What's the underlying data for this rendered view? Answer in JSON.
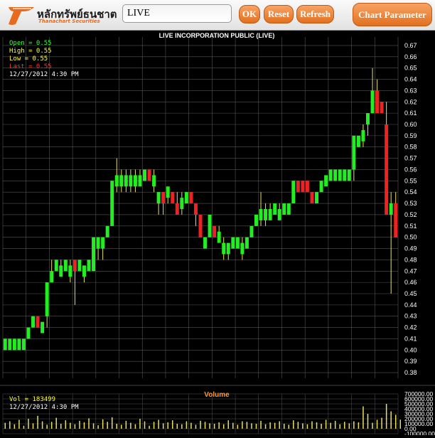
{
  "header": {
    "brand_text": "หลักทรัพย์ธนชาต",
    "brand_sub": "Thanachart Securities",
    "symbol_value": "LIVE",
    "ok_label": "OK",
    "reset_label": "Reset",
    "refresh_label": "Refresh",
    "chart_param_label": "Chart Parameter"
  },
  "ohlc": {
    "open": "Open = 0.55",
    "high": "High = 0.55",
    "low": "Low = 0.55",
    "last": "Last = 0.55",
    "timestamp": "12/27/2012 4:30 PM"
  },
  "volume_panel": {
    "title": "Volume",
    "vol_text": "Vol = 183499",
    "timestamp": "12/27/2012 4:30 PM"
  },
  "colors": {
    "up": "#22ee22",
    "down": "#ee2222",
    "wick": "#e8e060",
    "grid": "#555555",
    "label": "#ffffff",
    "open_label": "#33ff33",
    "high_label": "#ffff33",
    "low_label": "#ffff33",
    "last_label": "#ff3333",
    "volume_title": "#ff9933"
  },
  "chart_data": [
    {
      "type": "candlestick",
      "title": "LIVE INCORPORATION PUBLIC (LIVE)",
      "ylim": [
        0.375,
        0.675
      ],
      "y_ticks": [
        "0.67",
        "0.66",
        "0.65",
        "0.64",
        "0.63",
        "0.62",
        "0.61",
        "0.60",
        "0.59",
        "0.58",
        "0.57",
        "0.56",
        "0.55",
        "0.54",
        "0.53",
        "0.52",
        "0.51",
        "0.50",
        "0.49",
        "0.48",
        "0.47",
        "0.46",
        "0.45",
        "0.44",
        "0.43",
        "0.42",
        "0.41",
        "0.40",
        "0.39",
        "0.38"
      ],
      "grid": true,
      "candles": [
        [
          0.4,
          0.41,
          0.4,
          0.41
        ],
        [
          0.4,
          0.41,
          0.4,
          0.41
        ],
        [
          0.4,
          0.41,
          0.4,
          0.41
        ],
        [
          0.4,
          0.41,
          0.4,
          0.41
        ],
        [
          0.4,
          0.41,
          0.4,
          0.41
        ],
        [
          0.41,
          0.42,
          0.41,
          0.42
        ],
        [
          0.42,
          0.43,
          0.42,
          0.43
        ],
        [
          0.43,
          0.43,
          0.42,
          0.42
        ],
        [
          0.42,
          0.42,
          0.42,
          0.42
        ],
        [
          0.43,
          0.46,
          0.42,
          0.46
        ],
        [
          0.46,
          0.48,
          0.46,
          0.47
        ],
        [
          0.47,
          0.48,
          0.47,
          0.48
        ],
        [
          0.47,
          0.48,
          0.47,
          0.47
        ],
        [
          0.47,
          0.48,
          0.47,
          0.48
        ],
        [
          0.47,
          0.48,
          0.46,
          0.47
        ],
        [
          0.48,
          0.48,
          0.44,
          0.47
        ],
        [
          0.47,
          0.48,
          0.47,
          0.48
        ],
        [
          0.47,
          0.47,
          0.46,
          0.47
        ],
        [
          0.47,
          0.48,
          0.47,
          0.48
        ],
        [
          0.47,
          0.5,
          0.47,
          0.5
        ],
        [
          0.49,
          0.5,
          0.48,
          0.5
        ],
        [
          0.49,
          0.5,
          0.48,
          0.5
        ],
        [
          0.5,
          0.51,
          0.5,
          0.51
        ],
        [
          0.51,
          0.55,
          0.51,
          0.55
        ],
        [
          0.55,
          0.57,
          0.54,
          0.55
        ],
        [
          0.55,
          0.56,
          0.54,
          0.55
        ],
        [
          0.55,
          0.56,
          0.54,
          0.55
        ],
        [
          0.55,
          0.56,
          0.54,
          0.55
        ],
        [
          0.55,
          0.56,
          0.54,
          0.55
        ],
        [
          0.55,
          0.56,
          0.55,
          0.55
        ],
        [
          0.55,
          0.56,
          0.55,
          0.56
        ],
        [
          0.56,
          0.56,
          0.55,
          0.55
        ],
        [
          0.55,
          0.56,
          0.54,
          0.55
        ],
        [
          0.53,
          0.54,
          0.52,
          0.54
        ],
        [
          0.54,
          0.54,
          0.52,
          0.53
        ],
        [
          0.54,
          0.54,
          0.53,
          0.54
        ],
        [
          0.54,
          0.54,
          0.53,
          0.53
        ],
        [
          0.53,
          0.54,
          0.52,
          0.52
        ],
        [
          0.53,
          0.54,
          0.52,
          0.53
        ],
        [
          0.53,
          0.54,
          0.53,
          0.54
        ],
        [
          0.54,
          0.54,
          0.53,
          0.53
        ],
        [
          0.53,
          0.53,
          0.51,
          0.52
        ],
        [
          0.52,
          0.52,
          0.5,
          0.5
        ],
        [
          0.49,
          0.5,
          0.49,
          0.5
        ],
        [
          0.5,
          0.52,
          0.5,
          0.52
        ],
        [
          0.51,
          0.51,
          0.5,
          0.5
        ],
        [
          0.5,
          0.51,
          0.5,
          0.5
        ],
        [
          0.49,
          0.5,
          0.48,
          0.49
        ],
        [
          0.49,
          0.49,
          0.48,
          0.49
        ],
        [
          0.49,
          0.5,
          0.49,
          0.5
        ],
        [
          0.49,
          0.5,
          0.49,
          0.5
        ],
        [
          0.49,
          0.5,
          0.48,
          0.49
        ],
        [
          0.49,
          0.5,
          0.49,
          0.5
        ],
        [
          0.5,
          0.51,
          0.5,
          0.51
        ],
        [
          0.51,
          0.52,
          0.51,
          0.52
        ],
        [
          0.52,
          0.54,
          0.51,
          0.52
        ],
        [
          0.52,
          0.53,
          0.51,
          0.52
        ],
        [
          0.52,
          0.53,
          0.52,
          0.52
        ],
        [
          0.52,
          0.53,
          0.52,
          0.53
        ],
        [
          0.52,
          0.53,
          0.52,
          0.52
        ],
        [
          0.52,
          0.53,
          0.52,
          0.53
        ],
        [
          0.52,
          0.53,
          0.52,
          0.53
        ],
        [
          0.53,
          0.55,
          0.53,
          0.55
        ],
        [
          0.55,
          0.55,
          0.54,
          0.54
        ],
        [
          0.55,
          0.55,
          0.54,
          0.54
        ],
        [
          0.55,
          0.55,
          0.54,
          0.54
        ],
        [
          0.54,
          0.54,
          0.53,
          0.53
        ],
        [
          0.53,
          0.54,
          0.53,
          0.54
        ],
        [
          0.54,
          0.55,
          0.54,
          0.55
        ],
        [
          0.55,
          0.55,
          0.55,
          0.55
        ],
        [
          0.55,
          0.56,
          0.55,
          0.56
        ],
        [
          0.55,
          0.56,
          0.55,
          0.56
        ],
        [
          0.55,
          0.56,
          0.55,
          0.56
        ],
        [
          0.55,
          0.56,
          0.55,
          0.56
        ],
        [
          0.55,
          0.56,
          0.55,
          0.56
        ],
        [
          0.56,
          0.59,
          0.55,
          0.59
        ],
        [
          0.58,
          0.59,
          0.58,
          0.59
        ],
        [
          0.59,
          0.6,
          0.58,
          0.59
        ],
        [
          0.6,
          0.61,
          0.59,
          0.61
        ],
        [
          0.61,
          0.65,
          0.61,
          0.63
        ],
        [
          0.63,
          0.64,
          0.61,
          0.61
        ],
        [
          0.62,
          0.62,
          0.61,
          0.61
        ],
        [
          0.6,
          0.62,
          0.52,
          0.52
        ],
        [
          0.52,
          0.54,
          0.45,
          0.53
        ],
        [
          0.53,
          0.54,
          0.5,
          0.5
        ]
      ]
    },
    {
      "type": "bar",
      "title": "Volume",
      "ylim": [
        -100000,
        700000
      ],
      "y_ticks": [
        "700000.00",
        "600000.00",
        "500000.00",
        "400000.00",
        "300000.00",
        "200000.00",
        "100000.00",
        "0.00",
        "-100000.00"
      ],
      "values": [
        120000,
        150000,
        90000,
        180000,
        60000,
        200000,
        110000,
        260000,
        150000,
        80000,
        140000,
        220000,
        100000,
        170000,
        120000,
        90000,
        160000,
        130000,
        210000,
        110000,
        70000,
        190000,
        140000,
        230000,
        100000,
        80000,
        160000,
        120000,
        90000,
        200000,
        150000,
        60000,
        140000,
        180000,
        110000,
        130000,
        170000,
        100000,
        90000,
        150000,
        120000,
        80000,
        160000,
        140000,
        110000,
        100000,
        130000,
        90000,
        170000,
        120000,
        80000,
        150000,
        140000,
        110000,
        100000,
        160000,
        90000,
        130000,
        120000,
        150000,
        100000,
        80000,
        170000,
        140000,
        110000,
        90000,
        150000,
        130000,
        100000,
        180000,
        120000,
        160000,
        90000,
        140000,
        110000,
        150000,
        130000,
        450000,
        300000,
        120000,
        180000,
        220000,
        500000,
        350000,
        280000,
        183499
      ]
    }
  ]
}
